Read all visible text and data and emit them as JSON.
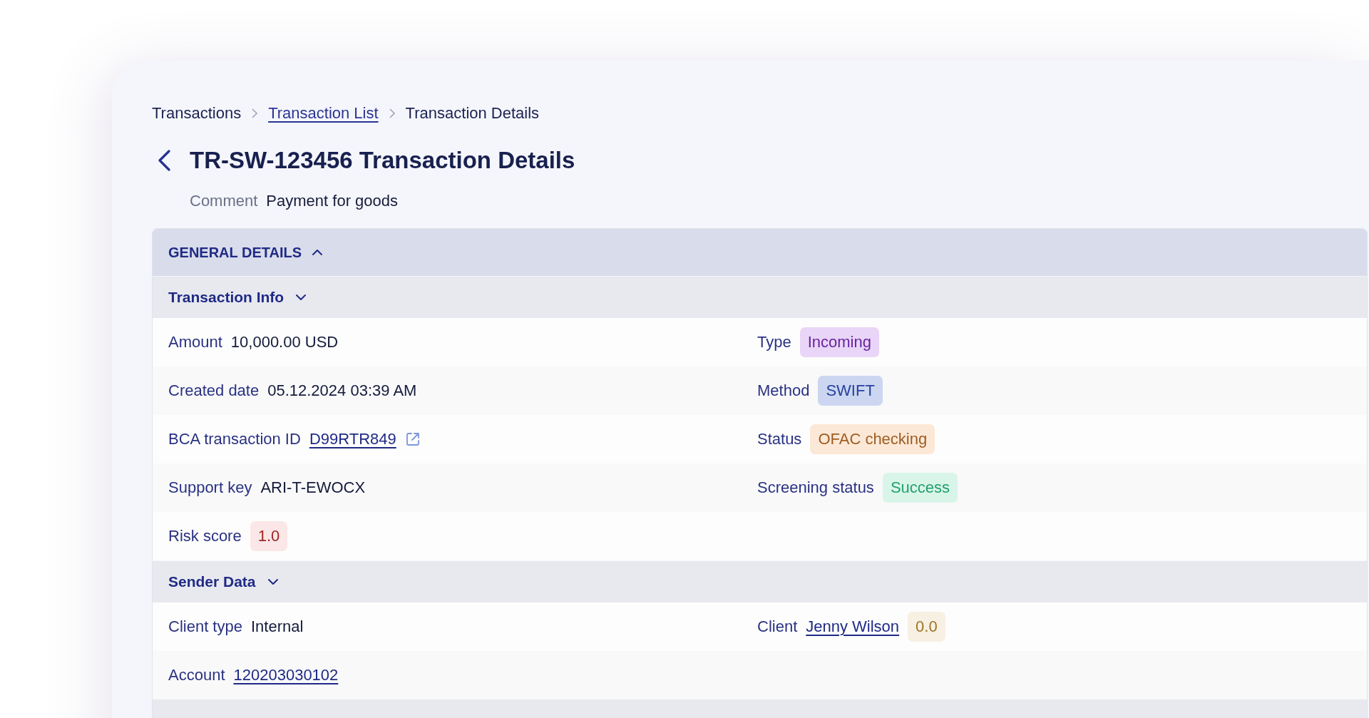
{
  "breadcrumbs": [
    {
      "label": "Transactions",
      "kind": "text"
    },
    {
      "label": "Transaction List",
      "kind": "link"
    },
    {
      "label": "Transaction Details",
      "kind": "current"
    }
  ],
  "title": "TR-SW-123456 Transaction Details",
  "comment": {
    "label": "Comment",
    "value": "Payment for goods"
  },
  "general_details": {
    "title": "GENERAL DETAILS",
    "expanded": true,
    "sections": [
      {
        "title": "Transaction Info",
        "expanded": true,
        "rows": [
          {
            "cells": [
              {
                "label": "Amount",
                "kind": "text",
                "value": "10,000.00 USD"
              },
              {
                "label": "Type",
                "kind": "badge",
                "value": "Incoming",
                "color": "#e8d5f7"
              }
            ]
          },
          {
            "cells": [
              {
                "label": "Created date",
                "kind": "text",
                "value": "05.12.2024 03:39 AM"
              },
              {
                "label": "Method",
                "kind": "badge",
                "value": "SWIFT",
                "color": "#cdd6f0"
              }
            ]
          },
          {
            "cells": [
              {
                "label": "BCA transaction ID",
                "kind": "link",
                "value": "D99RTR849",
                "external": true
              },
              {
                "label": "Status",
                "kind": "badge",
                "value": "OFAC checking",
                "color": "#fce8d6"
              }
            ]
          },
          {
            "cells": [
              {
                "label": "Support key",
                "kind": "text",
                "value": "ARI-T-EWOCX"
              },
              {
                "label": "Screening status",
                "kind": "badge",
                "value": "Success",
                "color": "#d9f5ea"
              }
            ]
          },
          {
            "cells": [
              {
                "label": "Risk score",
                "kind": "badge",
                "value": "1.0",
                "color": "#fbe7e7"
              }
            ]
          }
        ]
      },
      {
        "title": "Sender Data",
        "expanded": true,
        "rows": [
          {
            "cells": [
              {
                "label": "Client type",
                "kind": "text",
                "value": "Internal"
              },
              {
                "label": "Client",
                "kind": "link",
                "value": "Jenny Wilson",
                "badge": {
                  "text": "0.0",
                  "color": "#f7f0e3"
                }
              }
            ]
          },
          {
            "cells": [
              {
                "label": "Account",
                "kind": "link",
                "value": "120203030102"
              }
            ]
          }
        ]
      }
    ]
  }
}
